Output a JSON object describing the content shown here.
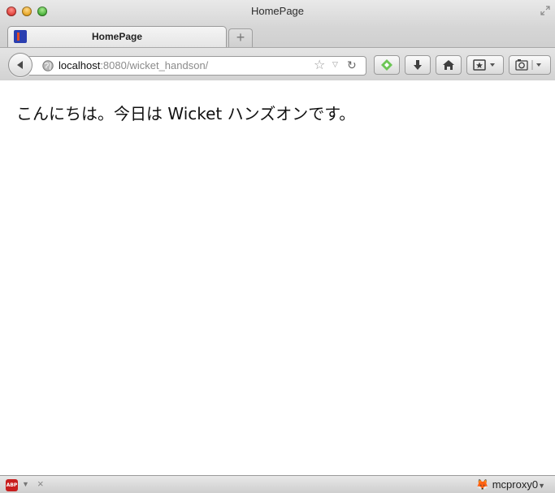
{
  "window": {
    "title": "HomePage"
  },
  "tab": {
    "label": "HomePage",
    "new_tab_label": "+"
  },
  "urlbar": {
    "host": "localhost",
    "rest": ":8080/wicket_handson/"
  },
  "page": {
    "text": "こんにちは。今日は Wicket ハンズオンです。"
  },
  "statusbar": {
    "adblock_label": "ABP",
    "proxy_label": "mcproxy0"
  },
  "icons": {
    "back": "back-arrow-icon",
    "globe": "globe-icon",
    "bookmark_star": "star-icon",
    "reload": "reload-icon",
    "feedly": "feedly-icon",
    "download": "download-icon",
    "home": "home-icon",
    "bookmarks": "bookmarks-icon",
    "screenshot": "camera-icon"
  },
  "colors": {
    "close": "#e0443e",
    "minimize": "#e6a627",
    "maximize": "#4cb33d",
    "feedly": "#6cc655"
  }
}
